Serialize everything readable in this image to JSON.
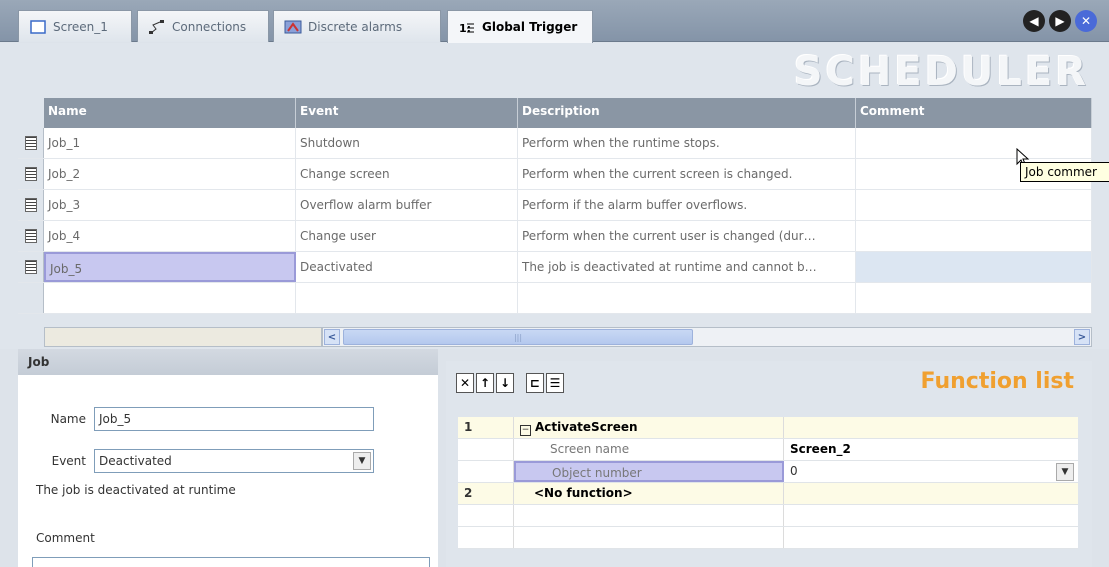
{
  "tabs": [
    {
      "label": "Screen_1",
      "icon": "screen-icon"
    },
    {
      "label": "Connections",
      "icon": "connections-icon"
    },
    {
      "label": "Discrete alarms",
      "icon": "alarms-icon"
    },
    {
      "label": "Global Trigger",
      "icon": "trigger-icon",
      "active": true
    }
  ],
  "header": {
    "title": "SCHEDULER"
  },
  "grid": {
    "columns": [
      "Name",
      "Event",
      "Description",
      "Comment"
    ],
    "rows": [
      {
        "name": "Job_1",
        "event": "Shutdown",
        "description": "Perform when the runtime stops.",
        "comment": ""
      },
      {
        "name": "Job_2",
        "event": "Change screen",
        "description": "Perform when the current screen is changed.",
        "comment": ""
      },
      {
        "name": "Job_3",
        "event": "Overflow alarm buffer",
        "description": "Perform if the alarm buffer overflows.",
        "comment": ""
      },
      {
        "name": "Job_4",
        "event": "Change user",
        "description": "Perform when the current user is changed (dur…",
        "comment": ""
      },
      {
        "name": "Job_5",
        "event": "Deactivated",
        "description": "The job is deactivated at runtime and cannot b…",
        "comment": ""
      }
    ],
    "selected_row": 4
  },
  "tooltip": {
    "text": "Job commer"
  },
  "job": {
    "header": "Job",
    "name_label": "Name",
    "name_value": "Job_5",
    "event_label": "Event",
    "event_value": "Deactivated",
    "description": "The job is deactivated at runtime",
    "comment_label": "Comment"
  },
  "function_list": {
    "title": "Function list",
    "rows": [
      {
        "num": "1",
        "func": "ActivateScreen"
      },
      {
        "param": "Screen name",
        "value": "Screen_2"
      },
      {
        "param": "Object number",
        "value": "0"
      },
      {
        "num": "2",
        "func": "<No function>"
      }
    ]
  },
  "colors": {
    "accent": "#f0a030",
    "header_bg": "#8a96a4",
    "selection": "#c8c8f0"
  }
}
